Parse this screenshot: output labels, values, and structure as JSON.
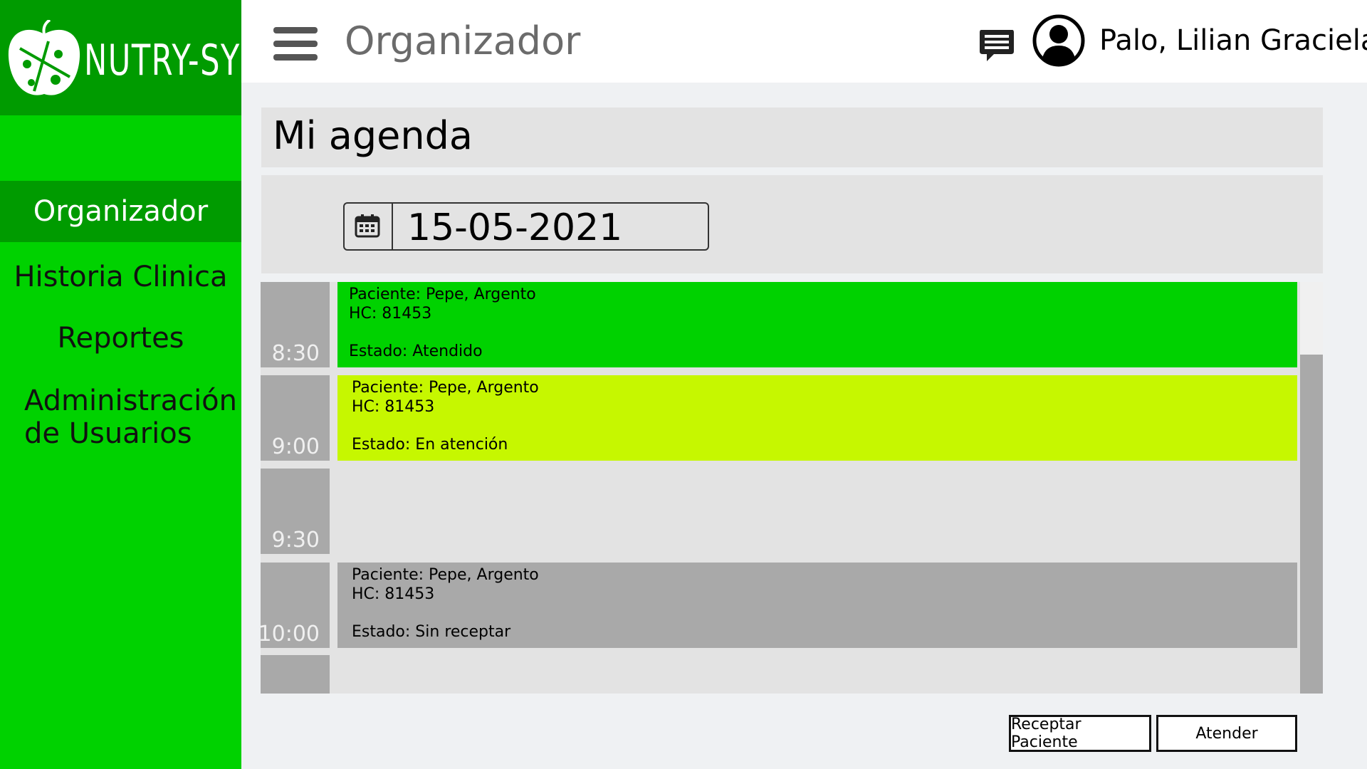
{
  "sidebar": {
    "brand": "NUTRY-SYS",
    "items": [
      {
        "label": "Organizador",
        "active": true
      },
      {
        "label": "Historia Clinica"
      },
      {
        "label": "Reportes"
      },
      {
        "label_line1": "Administración",
        "label_line2": "de Usuarios"
      }
    ]
  },
  "header": {
    "title": "Organizador",
    "user_name": "Palo, Lilian Graciela",
    "icons": [
      "menu-icon",
      "chat-icon",
      "user-avatar-icon"
    ]
  },
  "main": {
    "title": "Mi agenda",
    "date": "15-05-2021",
    "slots": [
      {
        "time": "8:30",
        "paciente": "Paciente: Pepe, Argento",
        "hc": "HC: 81453",
        "estado": "Estado: Atendido",
        "color": "#00d200"
      },
      {
        "time": "9:00",
        "paciente": "Paciente: Pepe, Argento",
        "hc": "HC: 81453",
        "estado": "Estado: En atención",
        "color": "#c6f700"
      },
      {
        "time": "9:30"
      },
      {
        "time": "10:00",
        "paciente": "Paciente: Pepe, Argento",
        "hc": "HC: 81453",
        "estado": "Estado: Sin receptar",
        "color": "#a9a9a9"
      }
    ],
    "buttons": {
      "receptar": "Receptar Paciente",
      "atender": "Atender"
    }
  },
  "colors": {
    "sidebar": "#00d200",
    "sidebar_dark": "#009b00",
    "panel": "#e3e3e3"
  }
}
